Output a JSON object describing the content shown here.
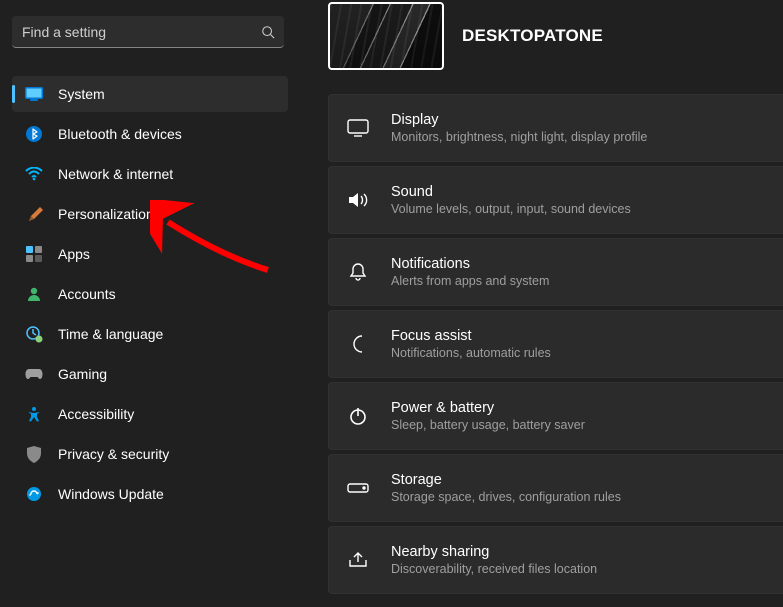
{
  "search": {
    "placeholder": "Find a setting"
  },
  "sidebar": {
    "items": [
      {
        "label": "System"
      },
      {
        "label": "Bluetooth & devices"
      },
      {
        "label": "Network & internet"
      },
      {
        "label": "Personalization"
      },
      {
        "label": "Apps"
      },
      {
        "label": "Accounts"
      },
      {
        "label": "Time & language"
      },
      {
        "label": "Gaming"
      },
      {
        "label": "Accessibility"
      },
      {
        "label": "Privacy & security"
      },
      {
        "label": "Windows Update"
      }
    ]
  },
  "header": {
    "device_name": "DESKTOPATONE"
  },
  "cards": [
    {
      "title": "Display",
      "subtitle": "Monitors, brightness, night light, display profile"
    },
    {
      "title": "Sound",
      "subtitle": "Volume levels, output, input, sound devices"
    },
    {
      "title": "Notifications",
      "subtitle": "Alerts from apps and system"
    },
    {
      "title": "Focus assist",
      "subtitle": "Notifications, automatic rules"
    },
    {
      "title": "Power & battery",
      "subtitle": "Sleep, battery usage, battery saver"
    },
    {
      "title": "Storage",
      "subtitle": "Storage space, drives, configuration rules"
    },
    {
      "title": "Nearby sharing",
      "subtitle": "Discoverability, received files location"
    }
  ]
}
